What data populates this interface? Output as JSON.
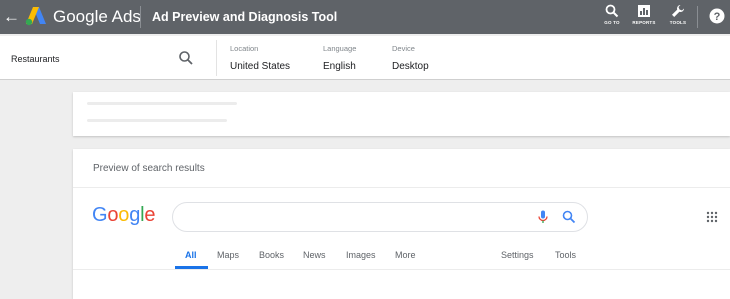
{
  "appbar": {
    "back_icon": "arrow-left-icon",
    "brand": "Google Ads",
    "tool_title": "Ad Preview and Diagnosis Tool",
    "nav": [
      {
        "label": "GO TO",
        "icon": "search-icon"
      },
      {
        "label": "REPORTS",
        "icon": "bar-chart-icon"
      },
      {
        "label": "TOOLS",
        "icon": "wrench-icon"
      }
    ],
    "help_icon": "help-icon",
    "bg_color": "#5f6368"
  },
  "settings": {
    "query": "Restaurants",
    "location": {
      "label": "Location",
      "value": "United States"
    },
    "language": {
      "label": "Language",
      "value": "English"
    },
    "device": {
      "label": "Device",
      "value": "Desktop"
    }
  },
  "preview": {
    "title": "Preview of search results",
    "google_logo": {
      "letters": [
        "G",
        "o",
        "o",
        "g",
        "l",
        "e"
      ],
      "colors": [
        "#4285f4",
        "#ea4335",
        "#fbbc05",
        "#4285f4",
        "#34a853",
        "#ea4335"
      ]
    },
    "tabs": [
      "All",
      "Maps",
      "Books",
      "News",
      "Images",
      "More",
      "Settings",
      "Tools"
    ],
    "active_tab": "All",
    "accent_color": "#1a73e8"
  }
}
